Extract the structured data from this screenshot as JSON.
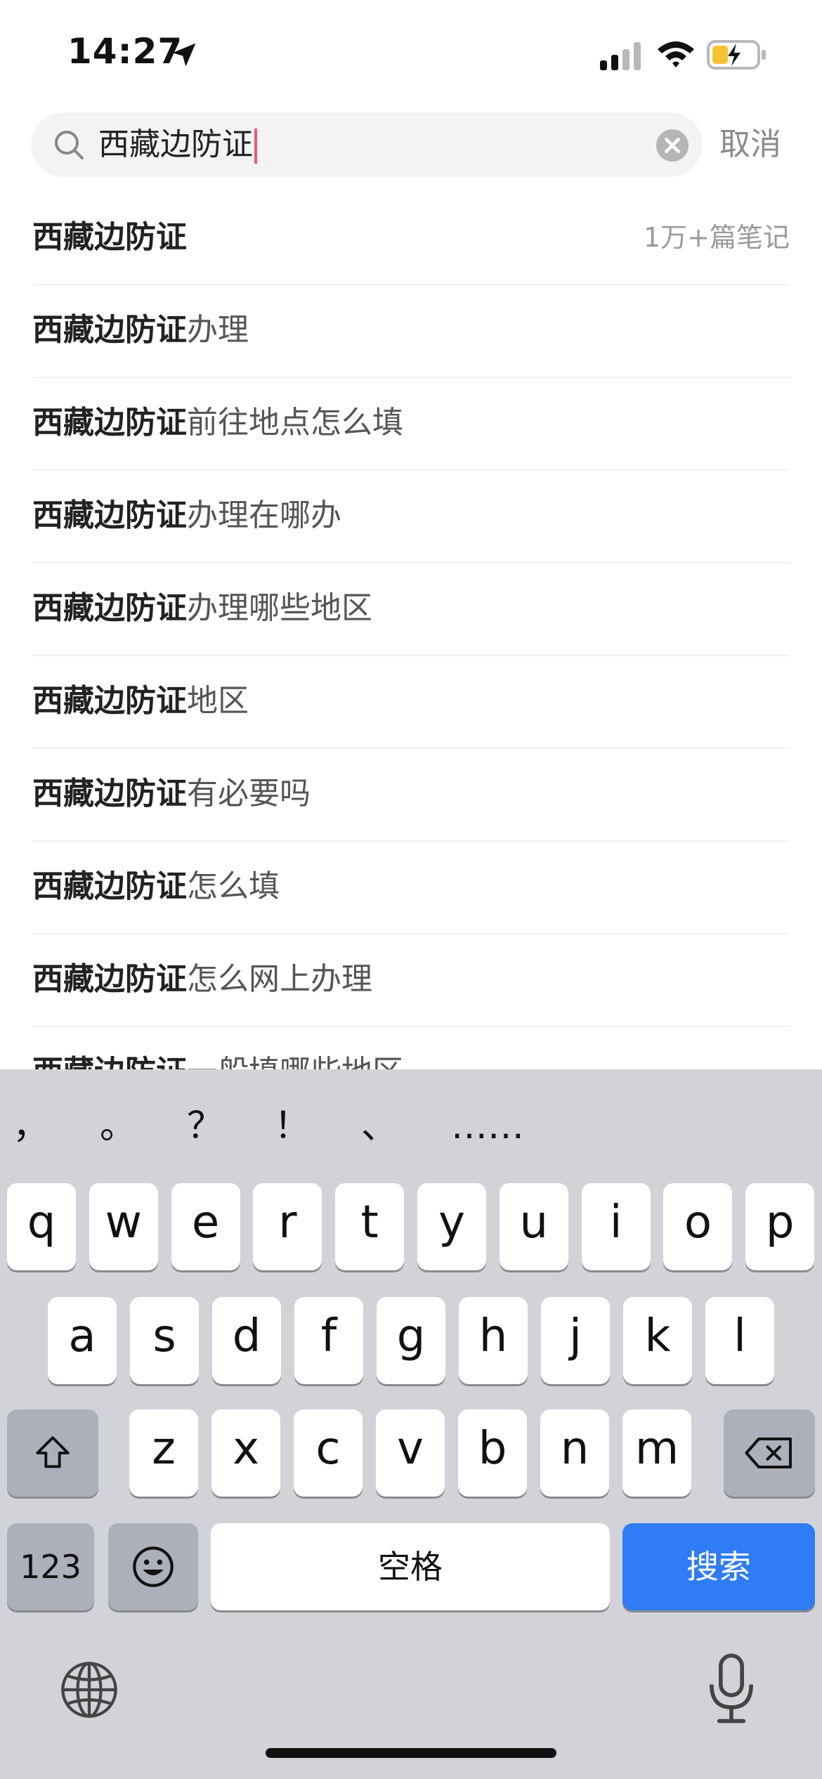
{
  "status_bar": {
    "time": "14:27"
  },
  "search": {
    "query": "西藏边防证",
    "cancel_label": "取消"
  },
  "suggestions": [
    {
      "bold": "西藏边防证",
      "rest": "",
      "count": "1万+篇笔记"
    },
    {
      "bold": "西藏边防证",
      "rest": "办理"
    },
    {
      "bold": "西藏边防证",
      "rest": "前往地点怎么填"
    },
    {
      "bold": "西藏边防证",
      "rest": "办理在哪办"
    },
    {
      "bold": "西藏边防证",
      "rest": "办理哪些地区"
    },
    {
      "bold": "西藏边防证",
      "rest": "地区"
    },
    {
      "bold": "西藏边防证",
      "rest": "有必要吗"
    },
    {
      "bold": "西藏边防证",
      "rest": "怎么填"
    },
    {
      "bold": "西藏边防证",
      "rest": "怎么网上办理"
    },
    {
      "bold": "西藏边防证",
      "rest": "一般填哪些地区"
    }
  ],
  "keyboard": {
    "punctuation": [
      "，",
      "。",
      "？",
      "！",
      "、",
      "……"
    ],
    "row1": [
      "q",
      "w",
      "e",
      "r",
      "t",
      "y",
      "u",
      "i",
      "o",
      "p"
    ],
    "row2": [
      "a",
      "s",
      "d",
      "f",
      "g",
      "h",
      "j",
      "k",
      "l"
    ],
    "row3": [
      "z",
      "x",
      "c",
      "v",
      "b",
      "n",
      "m"
    ],
    "numbers_label": "123",
    "space_label": "空格",
    "search_label": "搜索",
    "accent_color": "#2f7cf6"
  }
}
